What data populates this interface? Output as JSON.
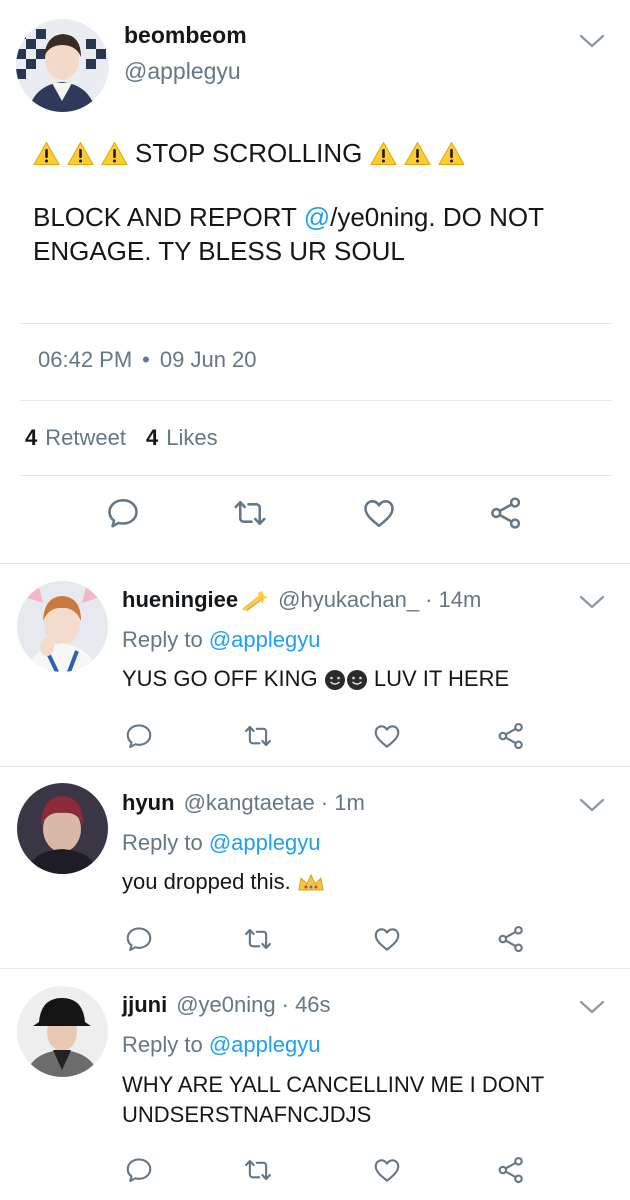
{
  "main_tweet": {
    "display_name": "beombeom",
    "handle": "@applegyu",
    "headline": "STOP SCROLLING",
    "body_prefix": "BLOCK AND REPORT ",
    "body_mention": "@",
    "body_suffix": "/ye0ning. DO NOT ENGAGE. TY BLESS UR SOUL",
    "time": "06:42 PM",
    "dot": "•",
    "date": "09 Jun 20",
    "retweet_count": "4",
    "retweet_label": "Retweet",
    "like_count": "4",
    "like_label": "Likes"
  },
  "replies": [
    {
      "display_name": "hueningiee",
      "handle": "@hyukachan_",
      "age": "· 14m",
      "reply_to_label": "Reply to",
      "reply_to_handle": "@applegyu",
      "text_before": "YUS GO OFF KING",
      "text_after": "LUV IT HERE"
    },
    {
      "display_name": "hyun",
      "handle": "@kangtaetae",
      "age": "· 1m",
      "reply_to_label": "Reply to",
      "reply_to_handle": "@applegyu",
      "text_before": "you dropped this."
    },
    {
      "display_name": "jjuni",
      "handle": "@ye0ning",
      "age": "· 46s",
      "reply_to_label": "Reply to",
      "reply_to_handle": "@applegyu",
      "text_before": "WHY ARE YALL CANCELLINV ME I DONT UNDSERSTNAFNCJDJS"
    }
  ],
  "icons": {
    "menu": "chevron-down-icon",
    "reply": "reply-icon",
    "retweet": "retweet-icon",
    "like": "heart-icon",
    "share": "share-icon",
    "warning": "warning-icon"
  },
  "colors": {
    "accent": "#1da1f2",
    "secondary_text": "#657786",
    "icon": "#657786",
    "divider": "#e1e8ed"
  }
}
